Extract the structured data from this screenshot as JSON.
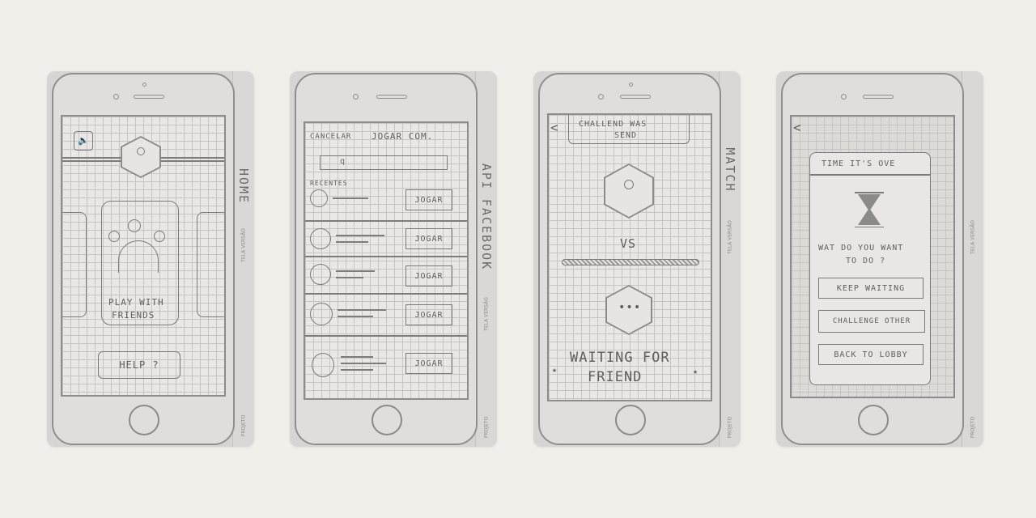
{
  "screens": [
    {
      "side_label": "HOME",
      "side_small_top": "TELA VERSÃO",
      "side_small_bottom": "PROJETO",
      "play_label_1": "PLAY WITH",
      "play_label_2": "FRIENDS",
      "help_label": "HELP ?"
    },
    {
      "side_label": "API FACEBOOK",
      "side_small_top": "TELA VERSÃO",
      "side_small_bottom": "PROJETO",
      "cancel_label": "CANCELAR",
      "title": "JOGAR COM.",
      "search_placeholder": "q",
      "recent_label": "RECENTES",
      "rows": [
        {
          "button": "JOGAR"
        },
        {
          "button": "JOGAR"
        },
        {
          "button": "JOGAR"
        },
        {
          "button": "JOGAR"
        },
        {
          "button": "JOGAR"
        }
      ]
    },
    {
      "side_label": "MATCH",
      "side_small_top": "TELA VERSÃO",
      "side_small_bottom": "PROJETO",
      "back_glyph": "<",
      "banner_line1": "CHALLEND WAS",
      "banner_line2": "SEND",
      "vs_label": "VS",
      "opponent_dots": "•••",
      "waiting_line1": "WAITING FOR",
      "waiting_line2": "FRIEND",
      "star_left": "★",
      "star_right": "★"
    },
    {
      "side_label": "",
      "side_small_top": "TELA VERSÃO",
      "side_small_bottom": "PROJETO",
      "back_glyph": "<",
      "dialog_title": "TIME IT'S OVE",
      "question_line1": "WAT DO YOU WANT",
      "question_line2": "TO DO ?",
      "keep_waiting": "KEEP WAITING",
      "challenge_other": "CHALLENGE OTHER",
      "back_to_lobby": "BACK TO LOBBY"
    }
  ]
}
